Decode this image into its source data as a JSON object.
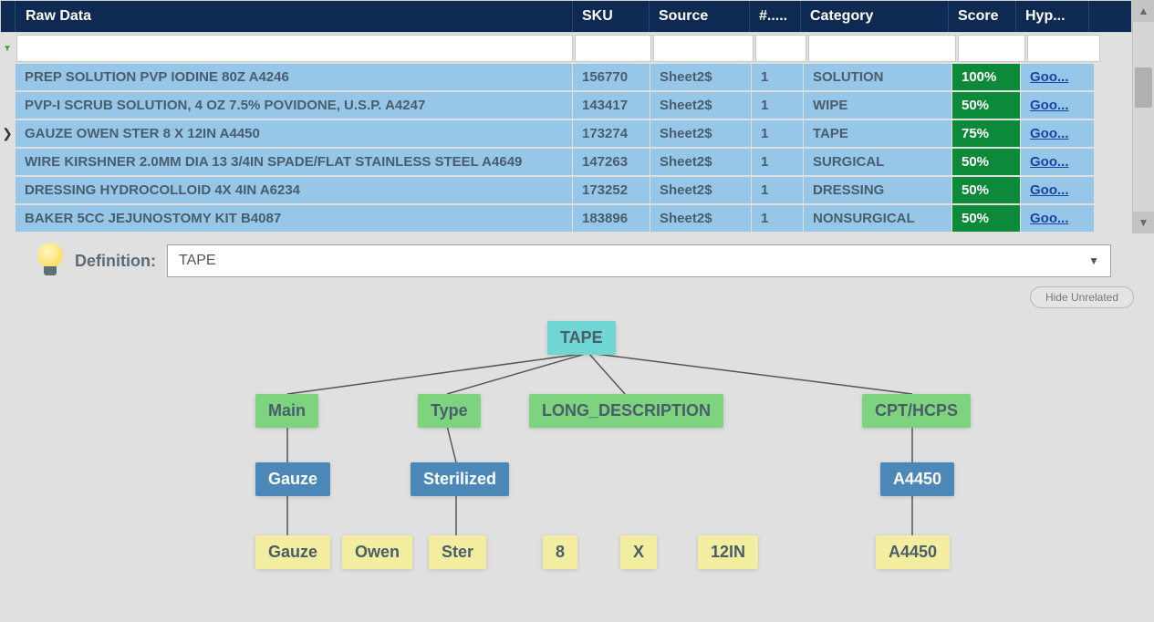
{
  "table": {
    "headers": {
      "raw": "Raw Data",
      "sku": "SKU",
      "source": "Source",
      "count": "#.....",
      "category": "Category",
      "score": "Score",
      "hyp": "Hyp..."
    },
    "link_text": "Goo...",
    "rows": [
      {
        "raw": "PREP SOLUTION PVP IODINE 80Z A4246",
        "sku": "156770",
        "source": "Sheet2$",
        "count": "1",
        "category": "SOLUTION",
        "score": "100%",
        "selected": false
      },
      {
        "raw": "PVP-I SCRUB SOLUTION, 4 OZ 7.5% POVIDONE, U.S.P. A4247",
        "sku": "143417",
        "source": "Sheet2$",
        "count": "1",
        "category": "WIPE",
        "score": "50%",
        "selected": false
      },
      {
        "raw": "GAUZE OWEN STER 8 X 12IN A4450",
        "sku": "173274",
        "source": "Sheet2$",
        "count": "1",
        "category": "TAPE",
        "score": "75%",
        "selected": true
      },
      {
        "raw": "WIRE KIRSHNER 2.0MM DIA 13 3/4IN SPADE/FLAT STAINLESS STEEL A4649",
        "sku": "147263",
        "source": "Sheet2$",
        "count": "1",
        "category": "SURGICAL",
        "score": "50%",
        "selected": false
      },
      {
        "raw": "DRESSING HYDROCOLLOID 4X 4IN A6234",
        "sku": "173252",
        "source": "Sheet2$",
        "count": "1",
        "category": "DRESSING",
        "score": "50%",
        "selected": false
      },
      {
        "raw": "BAKER 5CC JEJUNOSTOMY KIT B4087",
        "sku": "183896",
        "source": "Sheet2$",
        "count": "1",
        "category": "NONSURGICAL",
        "score": "50%",
        "selected": false
      }
    ]
  },
  "definition": {
    "label": "Definition:",
    "value": "TAPE"
  },
  "hide_unrelated_label": "Hide Unrelated",
  "tree": {
    "root": "TAPE",
    "attrs": {
      "main": "Main",
      "type": "Type",
      "long": "LONG_DESCRIPTION",
      "cpt": "CPT/HCPS"
    },
    "vals": {
      "main": "Gauze",
      "type": "Sterilized",
      "cpt": "A4450"
    },
    "tokens": {
      "t0": "Gauze",
      "t1": "Owen",
      "t2": "Ster",
      "t3": "8",
      "t4": "X",
      "t5": "12IN",
      "t6": "A4450"
    }
  }
}
